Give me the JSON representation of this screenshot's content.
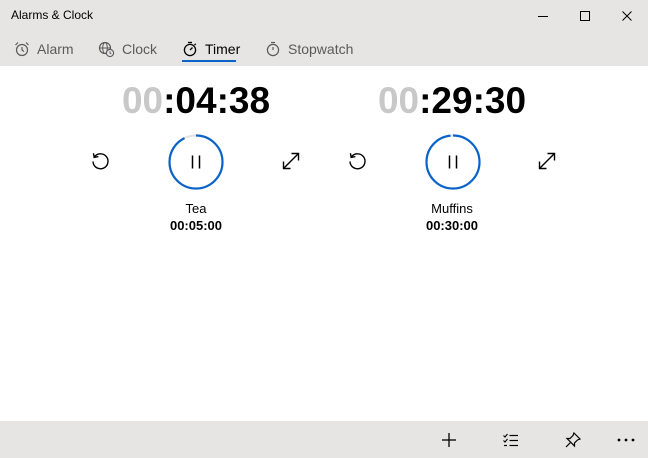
{
  "window": {
    "title": "Alarms & Clock"
  },
  "tabs": [
    {
      "label": "Alarm",
      "icon": "alarm-icon",
      "active": false
    },
    {
      "label": "Clock",
      "icon": "globe-clock-icon",
      "active": false
    },
    {
      "label": "Timer",
      "icon": "timer-icon",
      "active": true
    },
    {
      "label": "Stopwatch",
      "icon": "stopwatch-icon",
      "active": false
    }
  ],
  "timers": [
    {
      "hours": "00",
      "remaining": ":04:38",
      "name": "Tea",
      "duration": "00:05:00",
      "progress": 0.927
    },
    {
      "hours": "00",
      "remaining": ":29:30",
      "name": "Muffins",
      "duration": "00:30:00",
      "progress": 0.983
    }
  ],
  "colors": {
    "accent": "#0a63c9",
    "chrome": "#e7e4e4",
    "dim_digits": "#c8c8c8"
  },
  "bottombar": {
    "icons": [
      "add-icon",
      "select-list-icon",
      "pin-icon",
      "more-icon"
    ]
  }
}
